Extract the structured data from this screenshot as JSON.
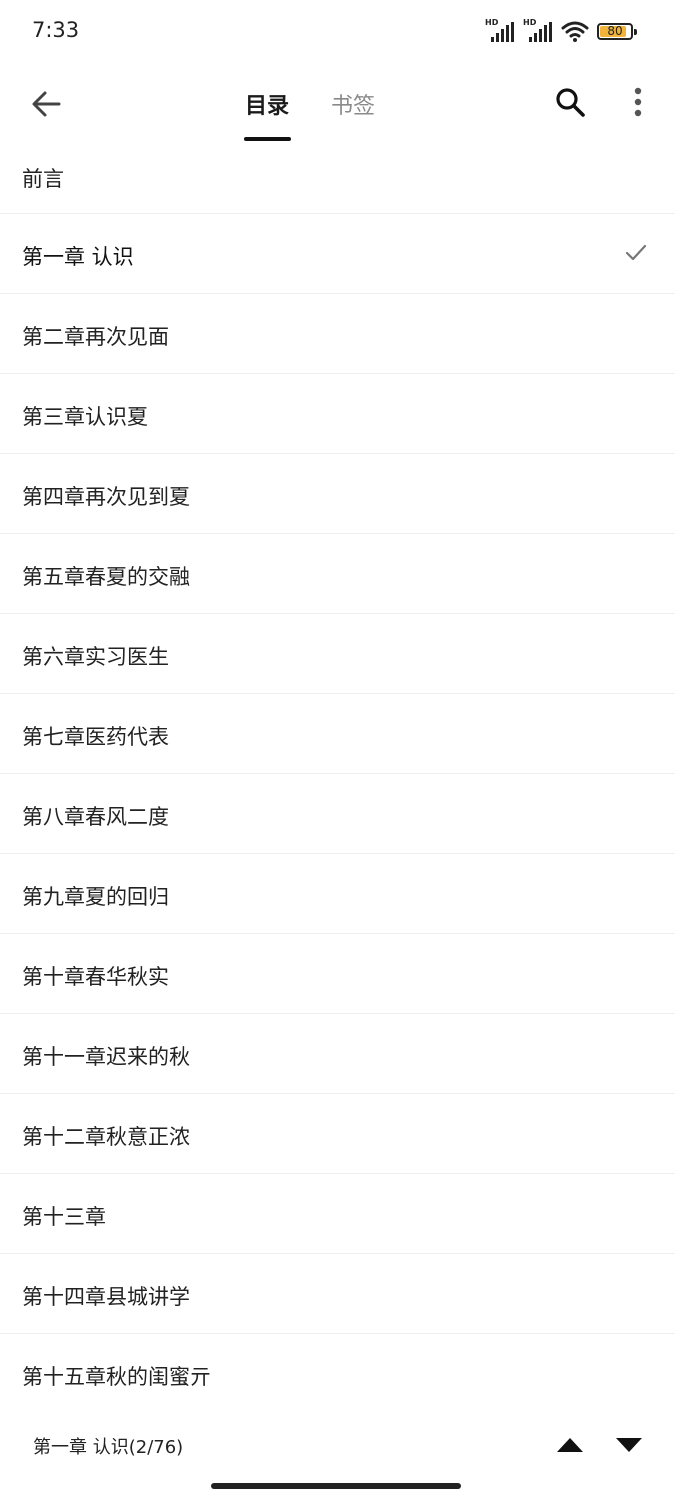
{
  "status_bar": {
    "time": "7:33",
    "battery": "80",
    "signal_label": "HD"
  },
  "toolbar": {
    "tabs": [
      {
        "label": "目录",
        "active": true
      },
      {
        "label": "书签",
        "active": false
      }
    ]
  },
  "chapters": [
    {
      "label": "前言"
    },
    {
      "label": "第一章 认识",
      "current": true
    },
    {
      "label": "第二章再次见面"
    },
    {
      "label": "第三章认识夏"
    },
    {
      "label": "第四章再次见到夏"
    },
    {
      "label": "第五章春夏的交融"
    },
    {
      "label": "第六章实习医生"
    },
    {
      "label": "第七章医药代表"
    },
    {
      "label": "第八章春风二度"
    },
    {
      "label": "第九章夏的回归"
    },
    {
      "label": "第十章春华秋实"
    },
    {
      "label": "第十一章迟来的秋"
    },
    {
      "label": "第十二章秋意正浓"
    },
    {
      "label": "第十三章"
    },
    {
      "label": "第十四章县城讲学"
    },
    {
      "label": "第十五章秋的闺蜜亓"
    }
  ],
  "bottom_bar": {
    "current_chapter": "第一章 认识(2/76)"
  },
  "colors": {
    "active_tab": "#1a1a1a",
    "inactive_tab": "#8a8a8a",
    "divider": "#eeeeee",
    "battery_fill": "#f2b33a"
  }
}
